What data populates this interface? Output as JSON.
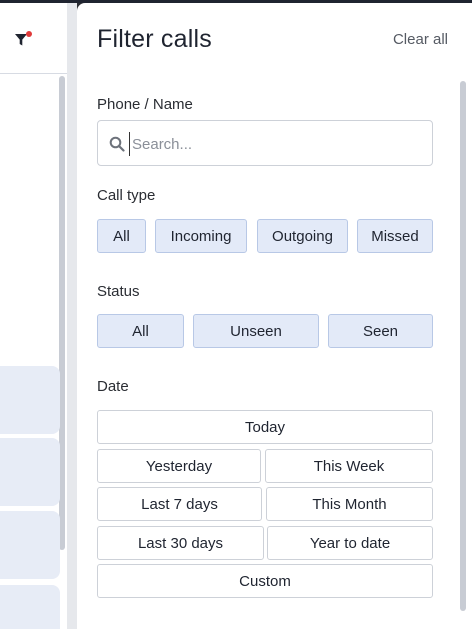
{
  "panel": {
    "title": "Filter calls",
    "clear_all": "Clear all"
  },
  "phone": {
    "label": "Phone / Name",
    "placeholder": "Search...",
    "value": ""
  },
  "call_type": {
    "label": "Call type",
    "options": [
      "All",
      "Incoming",
      "Outgoing",
      "Missed"
    ]
  },
  "status": {
    "label": "Status",
    "options": [
      "All",
      "Unseen",
      "Seen"
    ]
  },
  "date": {
    "label": "Date",
    "options": [
      "Today",
      "Yesterday",
      "This Week",
      "Last 7 days",
      "This Month",
      "Last 30 days",
      "Year to date",
      "Custom"
    ]
  },
  "icons": {
    "filter": "filter-icon",
    "search": "search-icon"
  },
  "colors": {
    "chip_bg": "#e3eaf8",
    "chip_border": "#b8c8e6",
    "notification_dot": "#e03a3a"
  }
}
